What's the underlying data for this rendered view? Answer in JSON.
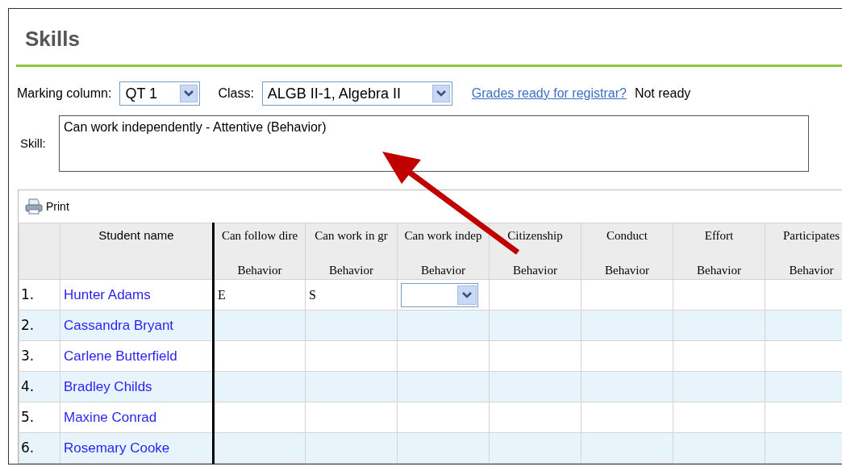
{
  "page": {
    "title": "Skills"
  },
  "filters": {
    "marking_column": {
      "label": "Marking column:",
      "value": "QT 1"
    },
    "class": {
      "label": "Class:",
      "value": "ALGB II-1, Algebra II"
    },
    "link": "Grades ready for registrar?",
    "status": "Not ready"
  },
  "skill": {
    "label": "Skill:",
    "value": "Can work independently - Attentive (Behavior)"
  },
  "toolbar": {
    "print": "Print"
  },
  "table": {
    "columns": [
      {},
      {
        "title": "Student name"
      },
      {
        "title": "Can follow dire",
        "subtitle": "Behavior"
      },
      {
        "title": "Can work in gr",
        "subtitle": "Behavior"
      },
      {
        "title": "Can work indep",
        "subtitle": "Behavior"
      },
      {
        "title": "Citizenship",
        "subtitle": "Behavior"
      },
      {
        "title": "Conduct",
        "subtitle": "Behavior"
      },
      {
        "title": "Effort",
        "subtitle": "Behavior"
      },
      {
        "title": "Participates",
        "subtitle": "Behavior"
      }
    ],
    "rows": [
      {
        "number": "1.",
        "name": "Hunter Adams",
        "grades": [
          {
            "kind": "text",
            "value": "E"
          },
          {
            "kind": "text",
            "value": "S"
          },
          {
            "kind": "select"
          },
          {
            "kind": "empty"
          },
          {
            "kind": "empty"
          },
          {
            "kind": "empty"
          },
          {
            "kind": "empty"
          }
        ]
      },
      {
        "number": "2.",
        "name": "Cassandra Bryant",
        "grades": [
          {
            "kind": "empty"
          },
          {
            "kind": "empty"
          },
          {
            "kind": "empty"
          },
          {
            "kind": "empty"
          },
          {
            "kind": "empty"
          },
          {
            "kind": "empty"
          },
          {
            "kind": "empty"
          }
        ]
      },
      {
        "number": "3.",
        "name": "Carlene Butterfield",
        "grades": [
          {
            "kind": "empty"
          },
          {
            "kind": "empty"
          },
          {
            "kind": "empty"
          },
          {
            "kind": "empty"
          },
          {
            "kind": "empty"
          },
          {
            "kind": "empty"
          },
          {
            "kind": "empty"
          }
        ]
      },
      {
        "number": "4.",
        "name": "Bradley Childs",
        "grades": [
          {
            "kind": "empty"
          },
          {
            "kind": "empty"
          },
          {
            "kind": "empty"
          },
          {
            "kind": "empty"
          },
          {
            "kind": "empty"
          },
          {
            "kind": "empty"
          },
          {
            "kind": "empty"
          }
        ]
      },
      {
        "number": "5.",
        "name": "Maxine Conrad",
        "grades": [
          {
            "kind": "empty"
          },
          {
            "kind": "empty"
          },
          {
            "kind": "empty"
          },
          {
            "kind": "empty"
          },
          {
            "kind": "empty"
          },
          {
            "kind": "empty"
          },
          {
            "kind": "empty"
          }
        ]
      },
      {
        "number": "6.",
        "name": "Rosemary Cooke",
        "grades": [
          {
            "kind": "empty"
          },
          {
            "kind": "empty"
          },
          {
            "kind": "empty"
          },
          {
            "kind": "empty"
          },
          {
            "kind": "empty"
          },
          {
            "kind": "empty"
          },
          {
            "kind": "empty"
          }
        ]
      }
    ]
  }
}
